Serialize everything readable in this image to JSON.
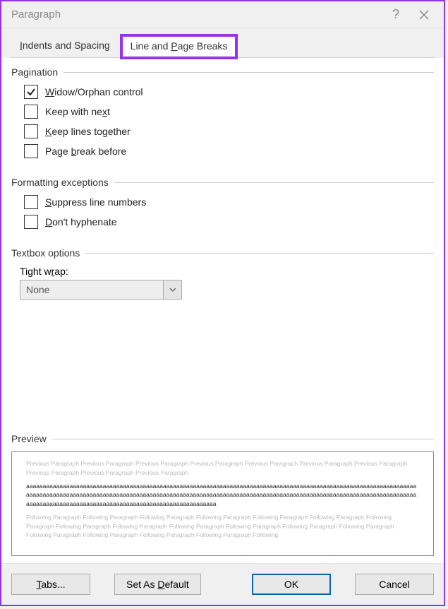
{
  "titlebar": {
    "title": "Paragraph"
  },
  "tabs": {
    "indents": {
      "label_pre": "I",
      "label_post": "ndents and Spacing",
      "u": "I"
    },
    "linebreaks": {
      "label_pre": "Line and ",
      "label_u": "P",
      "label_post": "age Breaks"
    }
  },
  "groups": {
    "pagination": {
      "title": "Pagination",
      "widow": {
        "pre": "",
        "u": "W",
        "post": "idow/Orphan control",
        "checked": true
      },
      "keepnext": {
        "pre": "Keep with ne",
        "u": "x",
        "post": "t",
        "checked": false
      },
      "keeplines": {
        "pre": "",
        "u": "K",
        "post": "eep lines together",
        "checked": false
      },
      "pagebreak": {
        "pre": "Page ",
        "u": "b",
        "post": "reak before",
        "checked": false
      }
    },
    "formatting": {
      "title": "Formatting exceptions",
      "suppress": {
        "pre": "",
        "u": "S",
        "post": "uppress line numbers",
        "checked": false
      },
      "hyphen": {
        "pre": "",
        "u": "D",
        "post": "on't hyphenate",
        "checked": false
      }
    },
    "textbox": {
      "title": "Textbox options",
      "tightwrap": {
        "pre": "Tight w",
        "u": "r",
        "post": "ap:"
      },
      "value": "None"
    },
    "preview": {
      "title": "Preview",
      "before": "Previous Paragraph Previous Paragraph Previous Paragraph Previous Paragraph Previous Paragraph Previous Paragraph Previous Paragraph Previous Paragraph Previous Paragraph Previous Paragraph",
      "main": "aaaaaaaaaaaaaaaaaaaaaaaaaaaaaaaaaaaaaaaaaaaaaaaaaaaaaaaaaaaaaaaaaaaaaaaaaaaaaaaaaaaaaaaaaaaaaaaaaaaaaaaaaaaaaaaaaaaaaaaaaaaaaaaaaaaaaaaaaaaaaaaaaaaaaaaaaaaaaaaaaaaaaaaaaaaaaaaaaaaaaaaaaaaaaaaaaaaaaaaaaaaaaaaaaaaaaaaaaaaaaaaaaaaaaaaaaaaaaaaaaaaaaaaaaaaaaaaaaaaaaaaaaaaaaaaaaaaaaaaaaaaaaaaaaaa",
      "after": "Following Paragraph Following Paragraph Following Paragraph Following Paragraph Following Paragraph Following Paragraph Following Paragraph Following Paragraph Following Paragraph Following Paragraph Following Paragraph Following Paragraph Following Paragraph Following Paragraph Following Paragraph Following Paragraph Following Paragraph Following"
    }
  },
  "buttons": {
    "tabs": {
      "pre": "",
      "u": "T",
      "post": "abs..."
    },
    "setdefault": {
      "pre": "Set As ",
      "u": "D",
      "post": "efault"
    },
    "ok": "OK",
    "cancel": "Cancel"
  }
}
